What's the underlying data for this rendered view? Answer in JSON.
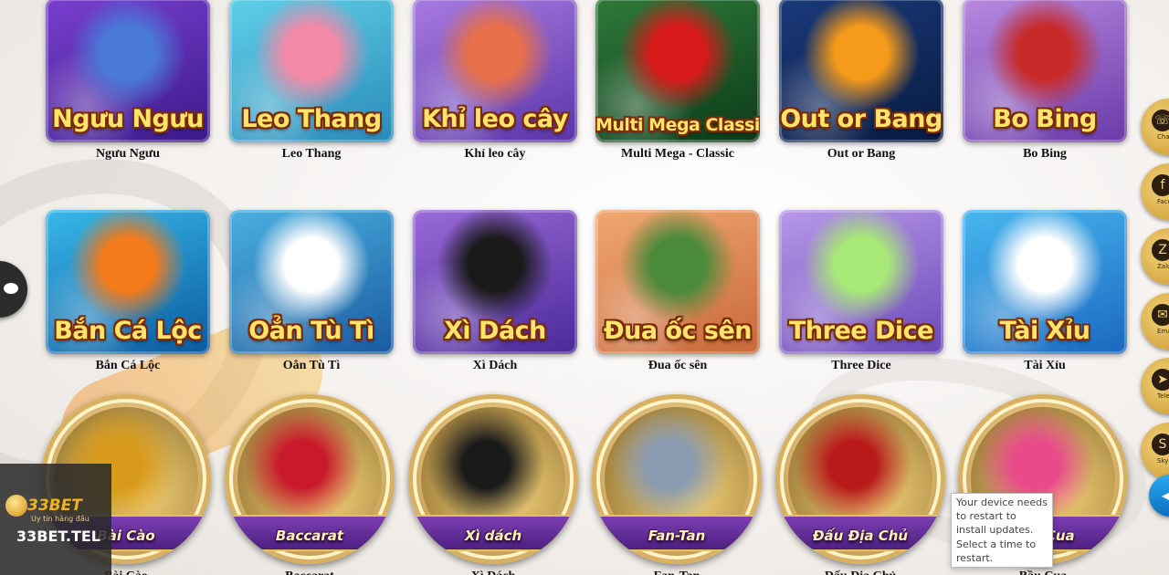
{
  "games_row1": [
    {
      "title": "Ngưu Ngưu",
      "caption": "Ngưu Ngưu",
      "bg": [
        "#7a3fd0",
        "#3a1a8a"
      ],
      "accent": "#4a7ad8"
    },
    {
      "title": "Leo Thang",
      "caption": "Leo Thang",
      "bg": [
        "#5fd0e8",
        "#2a8ab8"
      ],
      "accent": "#f28aa8"
    },
    {
      "title": "Khỉ leo cây",
      "caption": "Khỉ leo cây",
      "bg": [
        "#a87be0",
        "#5a34a8"
      ],
      "accent": "#e8704a"
    },
    {
      "title": "Multi Mega Classic",
      "caption": "Multi Mega - Classic",
      "bg": [
        "#2e7a3a",
        "#0d3a18"
      ],
      "accent": "#d81a1a"
    },
    {
      "title": "Out or Bang",
      "caption": "Out or Bang",
      "bg": [
        "#1a3a7a",
        "#081a40"
      ],
      "accent": "#f59a1a"
    },
    {
      "title": "Bo Bing",
      "caption": "Bo Bing",
      "bg": [
        "#b88ae0",
        "#6a3aa8"
      ],
      "accent": "#c82a2a"
    }
  ],
  "games_row2": [
    {
      "title": "Bắn Cá Lộc",
      "caption": "Bắn Cá Lộc",
      "bg": [
        "#38b8e8",
        "#0a5aa0"
      ],
      "accent": "#f57a1a"
    },
    {
      "title": "Oẳn Tù Tì",
      "caption": "Oẳn Tù Tì",
      "bg": [
        "#4ab0e0",
        "#1a5aa0"
      ],
      "accent": "#ffffff"
    },
    {
      "title": "Xì Dách",
      "caption": "Xì Dách",
      "bg": [
        "#9a6ad8",
        "#4a2a98"
      ],
      "accent": "#1a1a1a"
    },
    {
      "title": "Đua ốc sên",
      "caption": "Đua ốc sên",
      "bg": [
        "#f0a870",
        "#c8683a"
      ],
      "accent": "#4a8a3a"
    },
    {
      "title": "Three Dice",
      "caption": "Three Dice",
      "bg": [
        "#b898e8",
        "#6a48b8"
      ],
      "accent": "#a8e878"
    },
    {
      "title": "Tài Xỉu",
      "caption": "Tài Xỉu",
      "bg": [
        "#48b8f0",
        "#1a68c0"
      ],
      "accent": "#ffffff"
    }
  ],
  "games_row3": [
    {
      "label": "Bài Cào",
      "caption": "Bài Cào",
      "accent": "#d89a1a"
    },
    {
      "label": "Baccarat",
      "caption": "Baccarat",
      "accent": "#c81a2a"
    },
    {
      "label": "Xì dách",
      "caption": "Xì Dách",
      "accent": "#1a1a1a"
    },
    {
      "label": "Fan-Tan",
      "caption": "Fan-Tan",
      "accent": "#8a9ab0"
    },
    {
      "label": "Đấu Địa Chủ",
      "caption": "Đấu Địa Chủ",
      "accent": "#b81a1a"
    },
    {
      "label": "Bầu Cua",
      "caption": "Bầu Cua",
      "accent": "#e84a8a"
    }
  ],
  "side_buttons": [
    {
      "label": "Chat",
      "icon": "☏",
      "icon_name": "headset-icon"
    },
    {
      "label": "Facebook",
      "icon": "f",
      "icon_name": "facebook-icon"
    },
    {
      "label": "Zalo",
      "icon": "Z",
      "icon_name": "zalo-icon"
    },
    {
      "label": "Email",
      "icon": "✉",
      "icon_name": "email-icon"
    },
    {
      "label": "Telegram",
      "icon": "➤",
      "icon_name": "telegram-icon"
    },
    {
      "label": "Skype",
      "icon": "S",
      "icon_name": "skype-icon"
    }
  ],
  "logo": {
    "brand": "33BET",
    "tagline": "Uy tín hàng đầu",
    "site": "33BET.TEL"
  },
  "toast": {
    "line1": "Your device needs to restart to install updates.",
    "line2": "Select a time to restart."
  }
}
